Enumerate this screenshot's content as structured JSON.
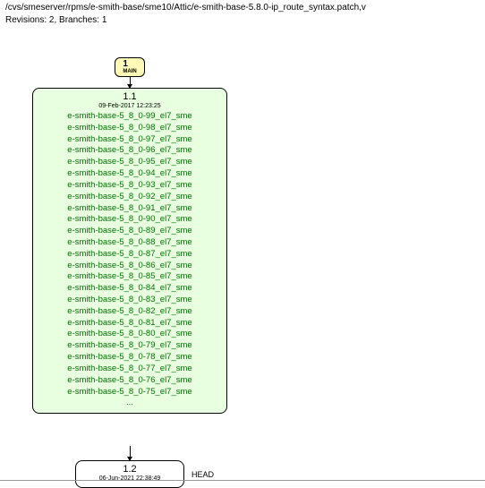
{
  "header": {
    "path": "/cvs/smeserver/rpms/e-smith-base/sme10/Attic/e-smith-base-5.8.0-ip_route_syntax.patch,v",
    "revs": "Revisions: 2, Branches: 1"
  },
  "main_node": {
    "label": "1",
    "branch": "MAIN"
  },
  "node1": {
    "title": "1.1",
    "date": "09-Feb-2017 12:23:25",
    "tags": [
      "e-smith-base-5_8_0-99_el7_sme",
      "e-smith-base-5_8_0-98_el7_sme",
      "e-smith-base-5_8_0-97_el7_sme",
      "e-smith-base-5_8_0-96_el7_sme",
      "e-smith-base-5_8_0-95_el7_sme",
      "e-smith-base-5_8_0-94_el7_sme",
      "e-smith-base-5_8_0-93_el7_sme",
      "e-smith-base-5_8_0-92_el7_sme",
      "e-smith-base-5_8_0-91_el7_sme",
      "e-smith-base-5_8_0-90_el7_sme",
      "e-smith-base-5_8_0-89_el7_sme",
      "e-smith-base-5_8_0-88_el7_sme",
      "e-smith-base-5_8_0-87_el7_sme",
      "e-smith-base-5_8_0-86_el7_sme",
      "e-smith-base-5_8_0-85_el7_sme",
      "e-smith-base-5_8_0-84_el7_sme",
      "e-smith-base-5_8_0-83_el7_sme",
      "e-smith-base-5_8_0-82_el7_sme",
      "e-smith-base-5_8_0-81_el7_sme",
      "e-smith-base-5_8_0-80_el7_sme",
      "e-smith-base-5_8_0-79_el7_sme",
      "e-smith-base-5_8_0-78_el7_sme",
      "e-smith-base-5_8_0-77_el7_sme",
      "e-smith-base-5_8_0-76_el7_sme",
      "e-smith-base-5_8_0-75_el7_sme",
      "..."
    ]
  },
  "node2": {
    "title": "1.2",
    "date": "06-Jun-2021 22:38:49"
  },
  "head": "HEAD"
}
